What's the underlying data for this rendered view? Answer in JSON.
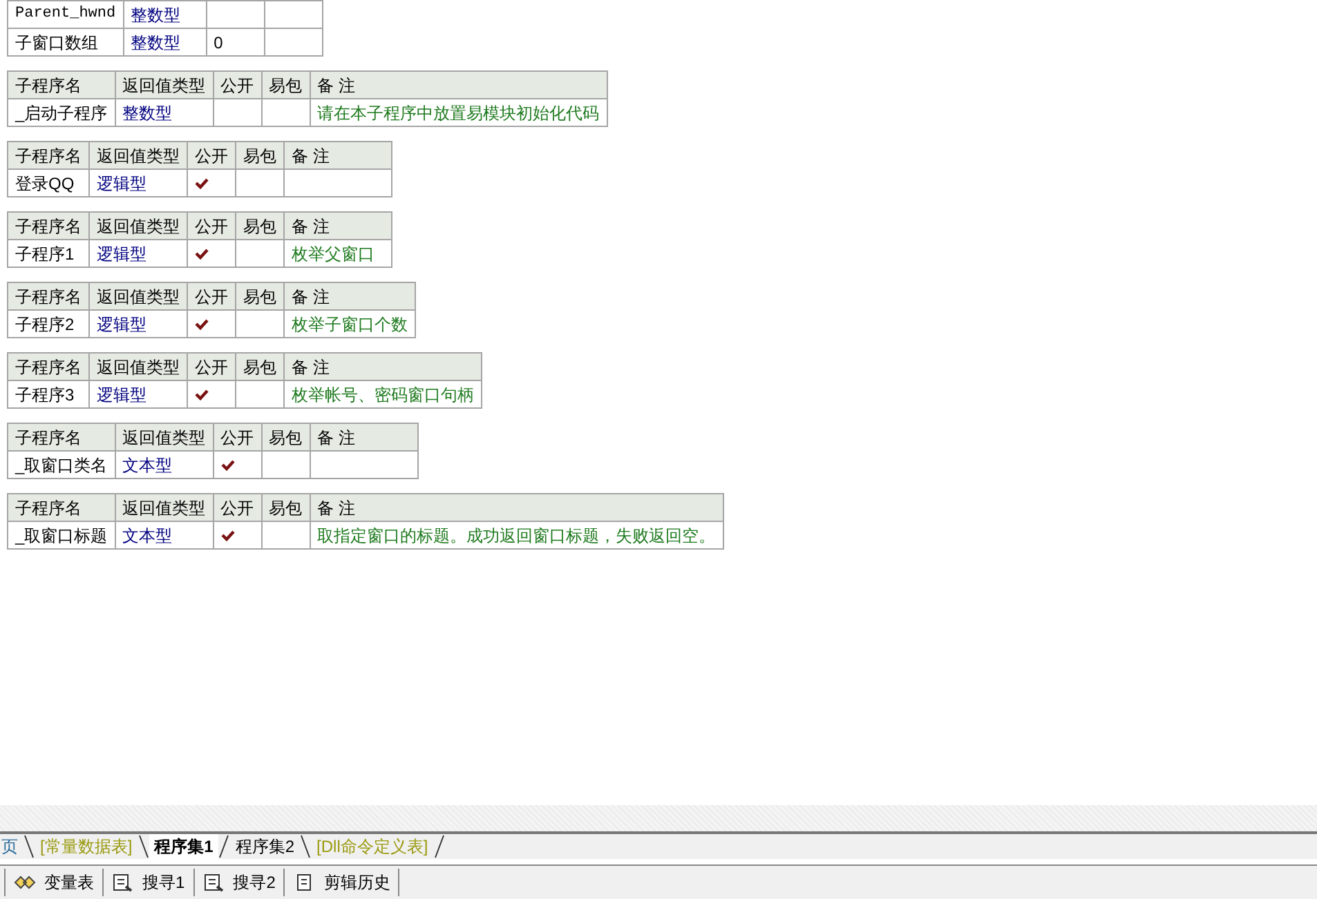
{
  "variables": {
    "rows": [
      {
        "name": "Parent_hwnd",
        "type": "整数型"
      },
      {
        "name": "子窗口数组",
        "type": "整数型",
        "value": "0"
      }
    ]
  },
  "subprograms": [
    {
      "columns": [
        "子程序名",
        "返回值类型",
        "公开",
        "易包",
        "备 注"
      ],
      "name": "_启动子程序",
      "return_type": "整数型",
      "public": false,
      "easy_package": false,
      "note": "请在本子程序中放置易模块初始化代码"
    },
    {
      "columns": [
        "子程序名",
        "返回值类型",
        "公开",
        "易包",
        "备 注"
      ],
      "name": "登录QQ",
      "return_type": "逻辑型",
      "public": true,
      "easy_package": false
    },
    {
      "columns": [
        "子程序名",
        "返回值类型",
        "公开",
        "易包",
        "备 注"
      ],
      "name": "子程序1",
      "return_type": "逻辑型",
      "public": true,
      "easy_package": false,
      "note": "枚举父窗口"
    },
    {
      "columns": [
        "子程序名",
        "返回值类型",
        "公开",
        "易包",
        "备 注"
      ],
      "name": "子程序2",
      "return_type": "逻辑型",
      "public": true,
      "easy_package": false,
      "note": "枚举子窗口个数"
    },
    {
      "columns": [
        "子程序名",
        "返回值类型",
        "公开",
        "易包",
        "备 注"
      ],
      "name": "子程序3",
      "return_type": "逻辑型",
      "public": true,
      "easy_package": false,
      "note": "枚举帐号、密码窗口句柄"
    },
    {
      "columns": [
        "子程序名",
        "返回值类型",
        "公开",
        "易包",
        "备 注"
      ],
      "name": "_取窗口类名",
      "return_type": "文本型",
      "public": true,
      "easy_package": false
    },
    {
      "columns": [
        "子程序名",
        "返回值类型",
        "公开",
        "易包",
        "备 注"
      ],
      "name": "_取窗口标题",
      "return_type": "文本型",
      "public": true,
      "easy_package": false,
      "note": "取指定窗口的标题。成功返回窗口标题，失败返回空。"
    }
  ],
  "editor_tabs": [
    {
      "label": "页",
      "kind": "page",
      "selected": false
    },
    {
      "label": "[常量数据表]",
      "kind": "table",
      "selected": false
    },
    {
      "label": "程序集1",
      "kind": "program",
      "selected": true
    },
    {
      "label": "程序集2",
      "kind": "program",
      "selected": false
    },
    {
      "label": "[Dll命令定义表]",
      "kind": "table",
      "selected": false
    }
  ],
  "panel_tabs": [
    {
      "label": "变量表",
      "kind": "variables"
    },
    {
      "label": "搜寻1",
      "kind": "search"
    },
    {
      "label": "搜寻2",
      "kind": "search"
    },
    {
      "label": "剪辑历史",
      "kind": "clipboard"
    }
  ]
}
